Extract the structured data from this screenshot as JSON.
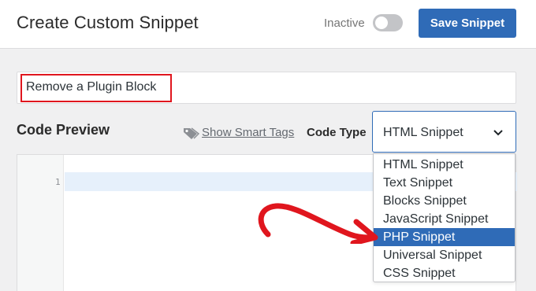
{
  "header": {
    "title": "Create Custom Snippet",
    "status_label": "Inactive",
    "save_label": "Save Snippet"
  },
  "snippet": {
    "name": "Remove a Plugin Block"
  },
  "code_preview": {
    "title": "Code Preview",
    "smart_tags_label": "Show Smart Tags",
    "code_type_label": "Code Type",
    "selected_type": "HTML Snippet",
    "line_number": "1"
  },
  "dropdown": {
    "options": [
      {
        "label": "HTML Snippet"
      },
      {
        "label": "Text Snippet"
      },
      {
        "label": "Blocks Snippet"
      },
      {
        "label": "JavaScript Snippet"
      },
      {
        "label": "PHP Snippet",
        "highlighted": true
      },
      {
        "label": "Universal Snippet"
      },
      {
        "label": "CSS Snippet"
      }
    ]
  },
  "colors": {
    "accent": "#2f6bb7",
    "annotation_red": "#e0161e"
  }
}
